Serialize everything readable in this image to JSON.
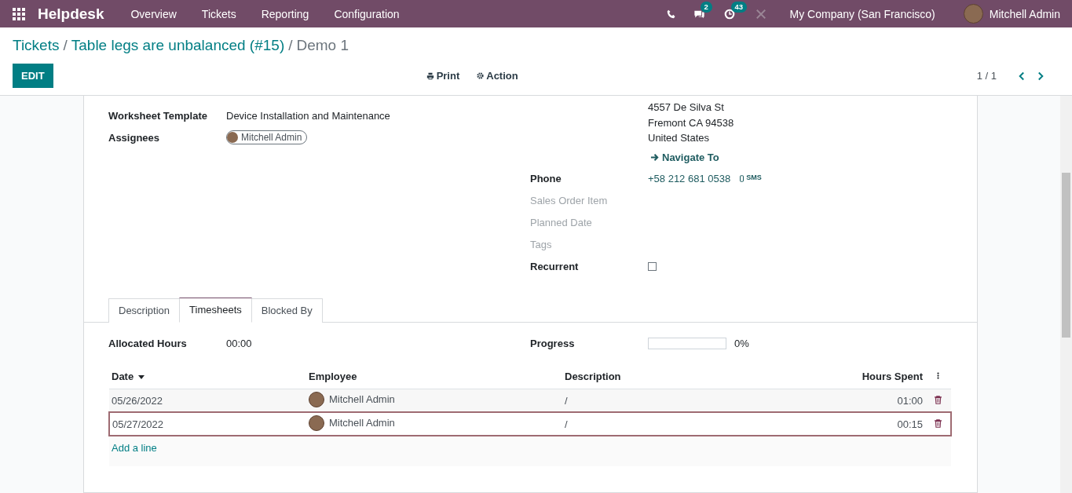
{
  "navbar": {
    "app_name": "Helpdesk",
    "menu": [
      "Overview",
      "Tickets",
      "Reporting",
      "Configuration"
    ],
    "messages_badge": "2",
    "activities_badge": "43",
    "company": "My Company (San Francisco)",
    "user": "Mitchell Admin"
  },
  "breadcrumbs": {
    "parents": [
      "Tickets",
      "Table legs are unbalanced (#15)"
    ],
    "separator": "/",
    "current": "Demo 1"
  },
  "toolbar": {
    "edit": "EDIT",
    "print": "Print",
    "action": "Action",
    "pager": "1 / 1"
  },
  "left_fields": [
    {
      "label": "Worksheet Template",
      "value": "Device Installation and Maintenance",
      "kind": "text"
    },
    {
      "label": "Assignees",
      "value": "Mitchell Admin",
      "kind": "tag"
    }
  ],
  "address": [
    "4557 De Silva St",
    "Fremont CA 94538",
    "United States"
  ],
  "navigate": "Navigate To",
  "right_fields": [
    {
      "label": "Phone",
      "value": "+58 212 681 0538",
      "sms": "SMS",
      "kind": "phone",
      "muted": false
    },
    {
      "label": "Sales Order Item",
      "kind": "empty",
      "muted": true
    },
    {
      "label": "Planned Date",
      "kind": "empty",
      "muted": true
    },
    {
      "label": "Tags",
      "kind": "empty",
      "muted": true
    },
    {
      "label": "Recurrent",
      "kind": "checkbox",
      "checked": false,
      "muted": false
    }
  ],
  "tabs": [
    {
      "label": "Description",
      "selected": false
    },
    {
      "label": "Timesheets",
      "selected": true
    },
    {
      "label": "Blocked By",
      "selected": false
    }
  ],
  "allocated": {
    "label": "Allocated Hours",
    "value": "00:00"
  },
  "progress": {
    "label": "Progress",
    "level": 0,
    "reading": "0%"
  },
  "table": {
    "columns": [
      "Date",
      "Employee",
      "Description",
      "Hours Spent"
    ],
    "rows": [
      {
        "date": "05/26/2022",
        "employee": "Mitchell Admin",
        "description": "/",
        "hours": "01:00",
        "selected": false
      },
      {
        "date": "05/27/2022",
        "employee": "Mitchell Admin",
        "description": "/",
        "hours": "00:15",
        "selected": true
      }
    ],
    "add_line": "Add a line"
  }
}
